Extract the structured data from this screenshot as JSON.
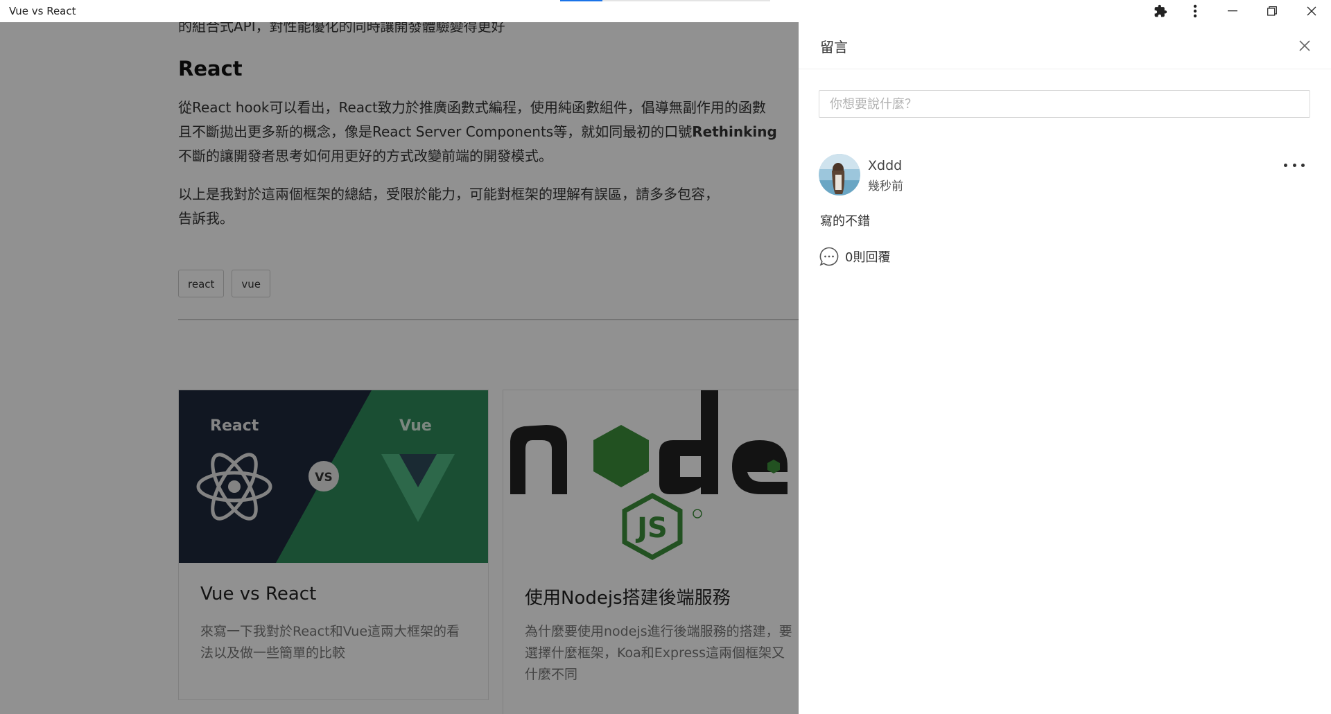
{
  "window": {
    "title": "Vue vs React",
    "load_progress": 0.2
  },
  "article": {
    "cut_line": "的組合式API，對性能優化的同時讓開發體驗變得更好",
    "heading": "React",
    "para1_line1": "從React hook可以看出，React致力於推廣函數式編程，使用純函數組件，倡導無副作用的函數",
    "para1_line2_pre": "且不斷拋出更多新的概念，像是React Server Components等，就如同最初的口號",
    "para1_line2_bold": "Rethinking",
    "para1_line3": "不斷的讓開發者思考如何用更好的方式改變前端的開發模式。",
    "para2_line1": "以上是我對於這兩個框架的總結，受限於能力，可能對框架的理解有誤區，請多多包容，",
    "para2_line2": "告訴我。",
    "tags": [
      "react",
      "vue"
    ]
  },
  "cards": [
    {
      "title": "Vue vs React",
      "desc": "來寫一下我對於React和Vue這兩大框架的看法以及做一些簡單的比較",
      "img_left_label": "React",
      "img_right_label": "Vue",
      "img_vs": "VS"
    },
    {
      "title": "使用Nodejs搭建後端服務",
      "desc": "為什麼要使用nodejs進行後端服務的搭建，要選擇什麼框架，Koa和Express這兩個框架又什麼不同",
      "img_word": "node",
      "img_js": "JS"
    }
  ],
  "drawer": {
    "title": "留言",
    "input_placeholder": "你想要說什麼？",
    "comment": {
      "user": "Xddd",
      "time": "幾秒前",
      "text": "寫的不錯",
      "replies": "0則回覆"
    }
  },
  "colors": {
    "react_bg": "#1f2a3c",
    "vue_green": "#2f8a5b",
    "node_green": "#2e7d32",
    "overlay": "rgba(0,0,0,0.43)"
  }
}
